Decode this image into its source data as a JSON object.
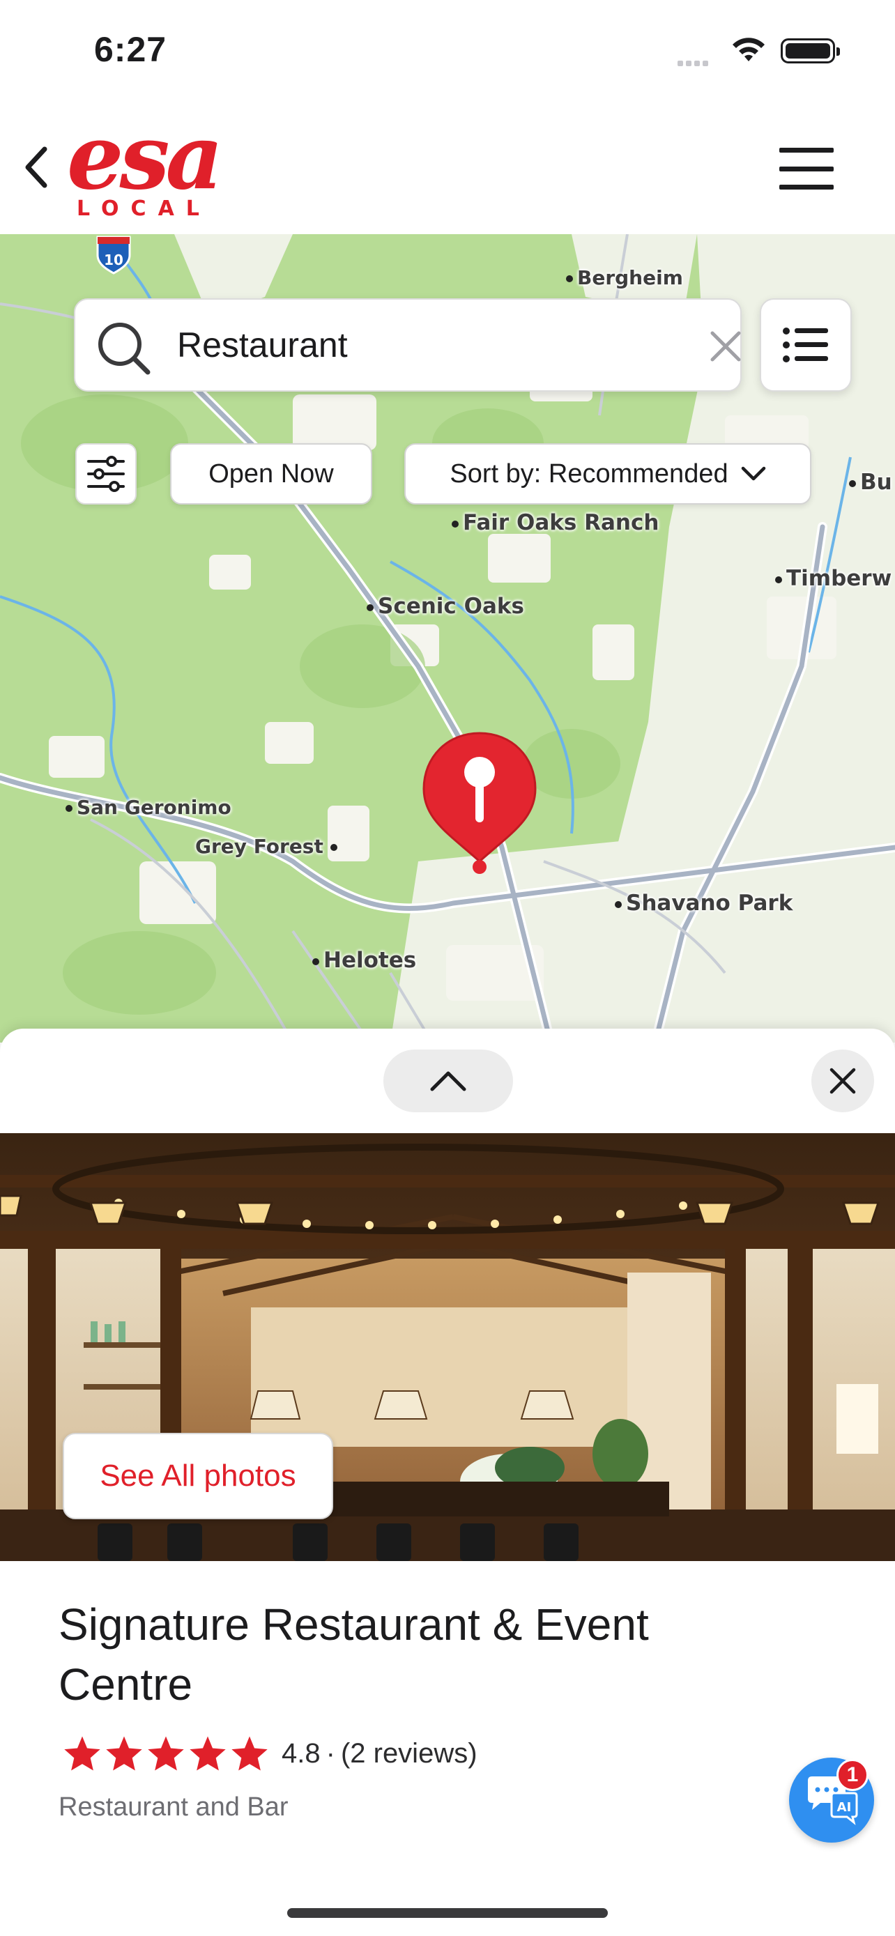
{
  "status_bar": {
    "time": "6:27"
  },
  "header": {
    "logo_main": "esa",
    "logo_sub": "LOCAL"
  },
  "map": {
    "highway_shield": "10",
    "places": {
      "bergheim": "Bergheim",
      "fair_oaks_ranch": "Fair Oaks Ranch",
      "scenic_oaks": "Scenic Oaks",
      "timberwood": "Timberw",
      "bu": "Bu",
      "san_geronimo": "San Geronimo",
      "grey_forest": "Grey Forest",
      "shavano_park": "Shavano Park",
      "helotes": "Helotes"
    }
  },
  "search": {
    "value": "Restaurant"
  },
  "filters": {
    "open_now": "Open Now",
    "sort_by": "Sort by: Recommended"
  },
  "listing": {
    "see_all_photos": "See All photos",
    "name": "Signature Restaurant & Event Centre",
    "rating": "4.8",
    "separator": "·",
    "reviews": "(2 reviews)",
    "stars": 5,
    "category": "Restaurant and Bar"
  },
  "chat": {
    "badge": "1"
  },
  "colors": {
    "brand_red": "#e0202a",
    "map_green": "#b7dc95",
    "chat_blue": "#2f8ff0"
  },
  "icons": [
    "back-chevron-icon",
    "hamburger-menu-icon",
    "search-icon",
    "clear-x-icon",
    "list-view-icon",
    "filter-sliders-icon",
    "chevron-down-icon",
    "map-pin-icon",
    "chevron-up-icon",
    "close-icon",
    "star-icon",
    "chat-ai-icon"
  ]
}
